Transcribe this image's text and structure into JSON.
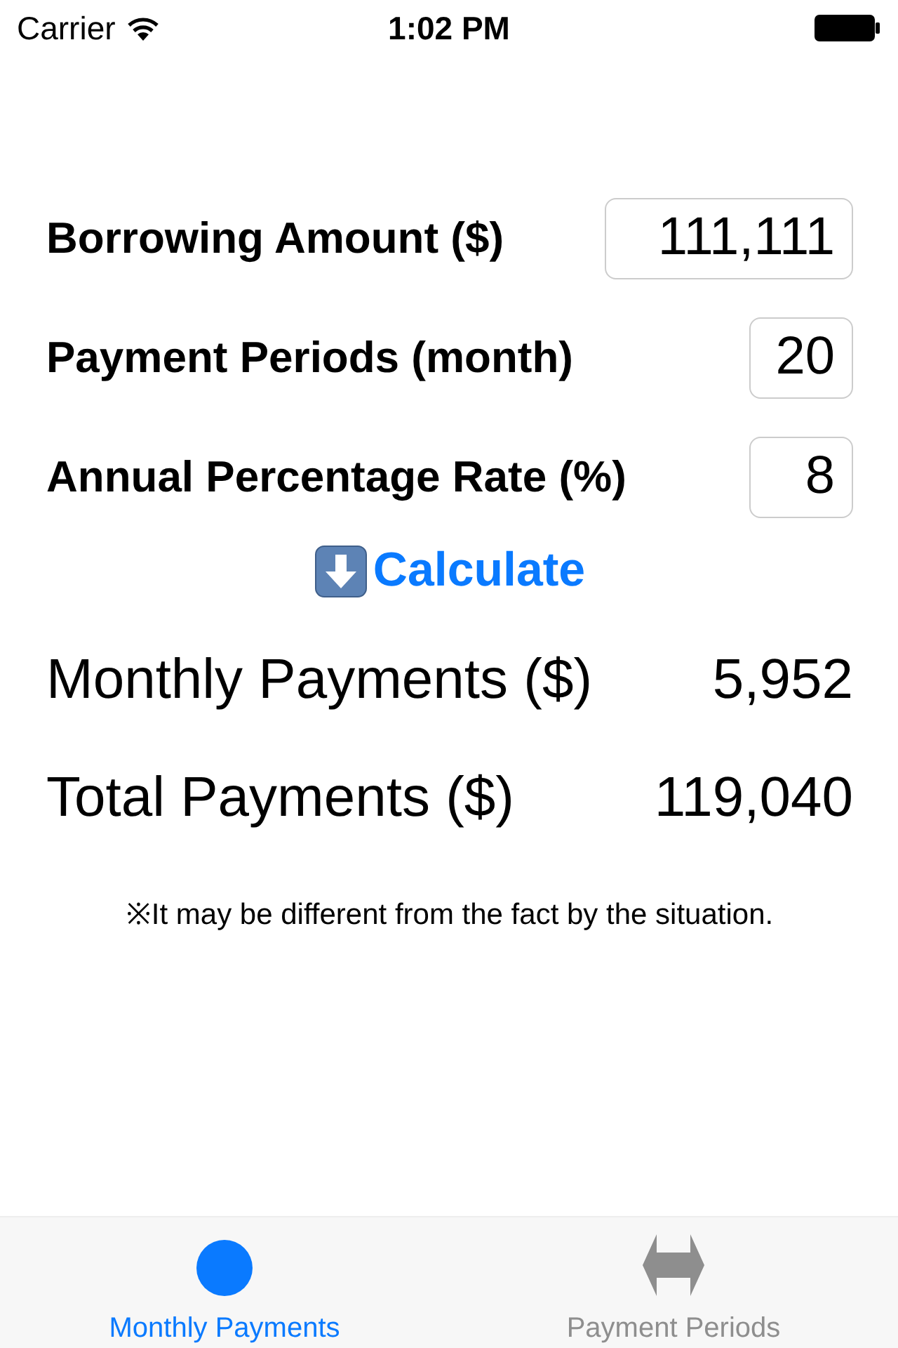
{
  "status_bar": {
    "carrier": "Carrier",
    "time": "1:02 PM"
  },
  "inputs": [
    {
      "label": "Borrowing Amount ($)",
      "value": "111,111"
    },
    {
      "label": "Payment Periods (month)",
      "value": "20"
    },
    {
      "label": "Annual Percentage Rate (%)",
      "value": "8"
    }
  ],
  "calculate_button": "Calculate",
  "results": [
    {
      "label": "Monthly Payments ($)",
      "value": "5,952"
    },
    {
      "label": "Total Payments ($)",
      "value": "119,040"
    }
  ],
  "note": "※It may be different from the fact by the situation.",
  "tabs": [
    {
      "label": "Monthly Payments",
      "selected": true
    },
    {
      "label": "Payment Periods",
      "selected": false
    }
  ]
}
